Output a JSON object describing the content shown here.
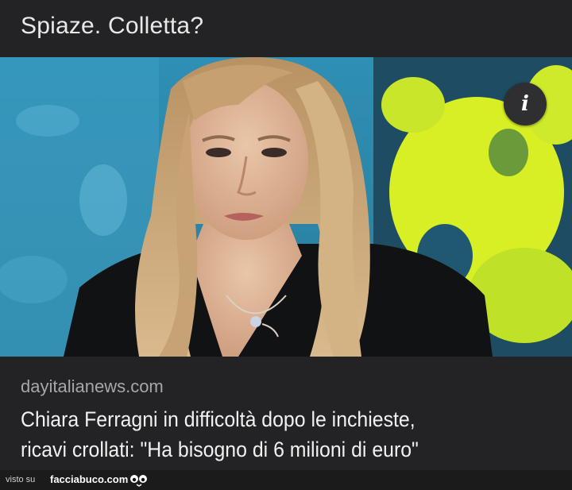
{
  "header": {
    "title": "Spiaze. Colletta?"
  },
  "card": {
    "source": "dayitalianews.com",
    "headline_line1": "Chiara Ferragni in difficoltà dopo le inchieste,",
    "headline_line2": "ricavi crollati: \"Ha bisogno di 6 milioni di euro\""
  },
  "info_button": {
    "glyph": "i",
    "icon": "info-icon"
  },
  "footer": {
    "visto_label": "visto su",
    "brand": "facciabuco.com",
    "brand_icon": "googly-eyes-icon"
  },
  "colors": {
    "background": "#232325",
    "headline": "#f1f1f2",
    "source": "#a7a7ab"
  }
}
